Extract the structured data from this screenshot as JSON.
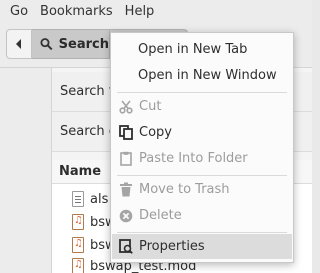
{
  "menubar": {
    "items": [
      "Go",
      "Bookmarks",
      "Help"
    ]
  },
  "toolbar": {
    "search_label": "Search"
  },
  "search_rows": [
    "Search fo",
    "Search co"
  ],
  "files": {
    "column_name": "Name",
    "rows": [
      {
        "name": "als",
        "icon": "text-file-icon"
      },
      {
        "name": "bsw",
        "icon": "audio-file-icon"
      },
      {
        "name": "bsw",
        "icon": "audio-file-icon"
      },
      {
        "name": "bswap_test.mod",
        "icon": "audio-file-icon"
      }
    ]
  },
  "context_menu": {
    "items": [
      {
        "label": "Open in New Tab",
        "enabled": true
      },
      {
        "label": "Open in New Window",
        "enabled": true
      },
      {
        "label": "Cut",
        "enabled": false,
        "icon": "scissors-icon"
      },
      {
        "label": "Copy",
        "enabled": true,
        "icon": "copy-icon"
      },
      {
        "label": "Paste Into Folder",
        "enabled": false,
        "icon": "paste-icon"
      },
      {
        "label": "Move to Trash",
        "enabled": false,
        "icon": "trash-icon"
      },
      {
        "label": "Delete",
        "enabled": false,
        "icon": "delete-icon"
      },
      {
        "label": "Properties",
        "enabled": true,
        "highlighted": true,
        "icon": "properties-icon"
      }
    ]
  },
  "colors": {
    "menu_bg": "#fbfbfb",
    "highlight": "#dcdcdc",
    "disabled_text": "#9c9c9c"
  }
}
